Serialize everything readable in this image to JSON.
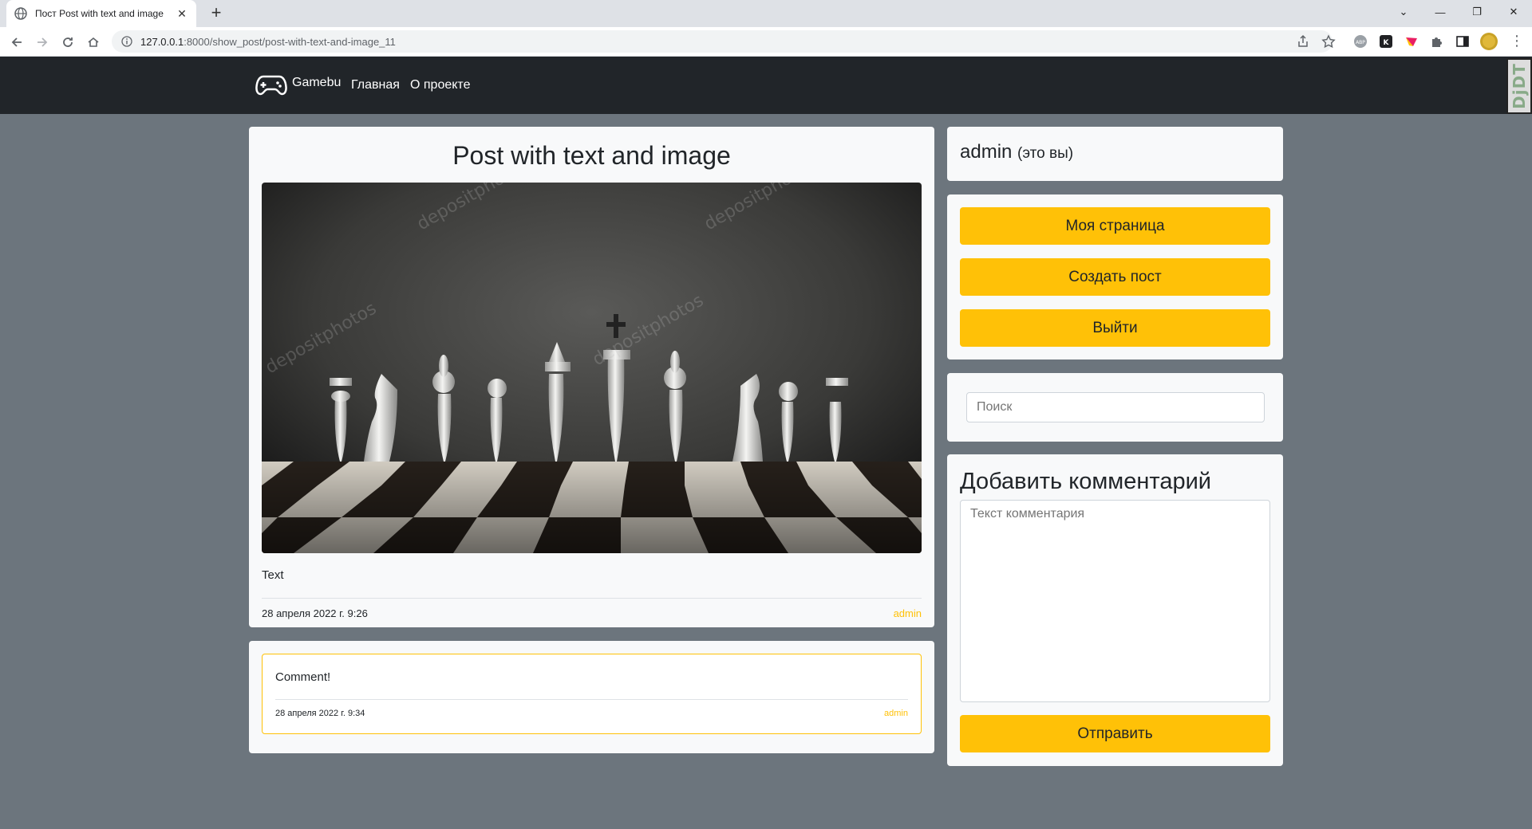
{
  "browser": {
    "tab_title": "Пост Post with text and image",
    "url_host": "127.0.0.1",
    "url_rest": ":8000/show_post/post-with-text-and-image_11"
  },
  "nav": {
    "brand": "Gamebu",
    "links": [
      "Главная",
      "О проекте"
    ],
    "djdt": "DjDT"
  },
  "post": {
    "title": "Post with text and image",
    "text": "Text",
    "date": "28 апреля 2022 г. 9:26",
    "author": "admin"
  },
  "comments": [
    {
      "text": "Comment!",
      "date": "28 апреля 2022 г. 9:34",
      "author": "admin"
    }
  ],
  "sidebar": {
    "user_name": "admin",
    "user_suffix": "(это вы)",
    "buttons": [
      "Моя страница",
      "Создать пост",
      "Выйти"
    ],
    "search_placeholder": "Поиск",
    "add_comment_title": "Добавить комментарий",
    "comment_placeholder": "Текст комментария",
    "submit_label": "Отправить"
  },
  "colors": {
    "accent": "#ffc107",
    "navbar": "#212529",
    "page_bg": "#6c757d",
    "card_bg": "#f8f9fa"
  }
}
